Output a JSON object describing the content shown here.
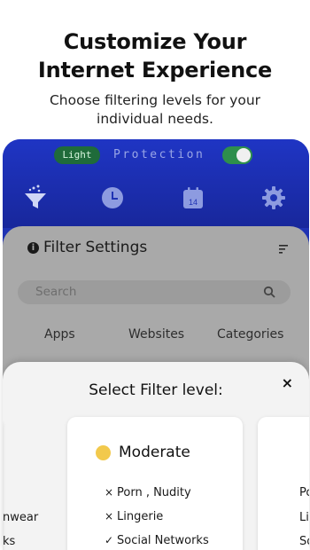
{
  "promo": {
    "headline_line1": "Customize Your",
    "headline_line2": "Internet Experience",
    "subtitle_line1": "Choose filtering levels for your",
    "subtitle_line2": "individual needs."
  },
  "header": {
    "level_pill": "Light",
    "protection_label": "Protection",
    "protection_on": true,
    "nav_icons": [
      "filter-icon",
      "clock-icon",
      "calendar-icon",
      "gear-icon"
    ],
    "calendar_day": "14"
  },
  "filter_settings": {
    "title": "Filter Settings",
    "search_placeholder": "Search",
    "tabs": [
      "Apps",
      "Websites",
      "Categories"
    ]
  },
  "sheet": {
    "title": "Select Filter level:",
    "close": "×",
    "level": {
      "name": "Moderate",
      "color": "#f2c94c",
      "items": [
        {
          "mark": "×",
          "label": "Porn , Nudity"
        },
        {
          "mark": "×",
          "label": "Lingerie"
        },
        {
          "mark": "✓",
          "label": "Social Networks"
        }
      ]
    },
    "left_peek": [
      "nwear",
      "ks"
    ],
    "right_peek": [
      "Po",
      "Li",
      "So"
    ]
  },
  "colors": {
    "header_blue": "#1f35c4",
    "card_gray": "#a9a9a9",
    "toggle_green": "#2e8f4c"
  }
}
